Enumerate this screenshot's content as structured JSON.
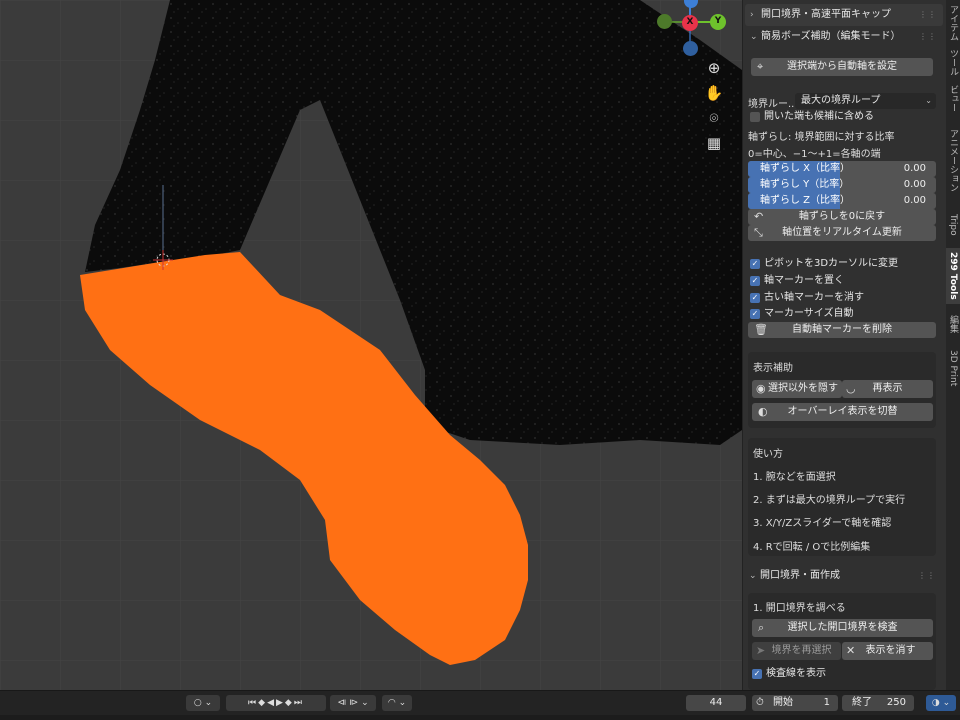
{
  "viewport": {
    "gizmo": {
      "x": "X",
      "y": "Y"
    }
  },
  "panel": {
    "sec1": {
      "title": "開口境界・高速平面キャップ"
    },
    "sec2": {
      "title": "簡易ボーズ補助（編集モード）",
      "auto_axis_btn": "選択端から自動軸を設定",
      "boundary_label": "境界ルー...",
      "boundary_value": "最大の境界ループ",
      "include_open_label": "開いた端も候補に含める",
      "axis_shift_label": "軸ずらし: 境界範囲に対する比率",
      "axis_hint": "0=中心、−1〜+1=各軸の端",
      "sliders": [
        {
          "name": "軸ずらし X（比率）",
          "value": "0.00"
        },
        {
          "name": "軸ずらし Y（比率）",
          "value": "0.00"
        },
        {
          "name": "軸ずらし Z（比率）",
          "value": "0.00"
        }
      ],
      "reset_btn": "軸ずらしを0に戻す",
      "realtime_btn": "軸位置をリアルタイム更新",
      "checks": [
        {
          "label": "ピボットを3Dカーソルに変更",
          "checked": true
        },
        {
          "label": "軸マーカーを置く",
          "checked": true
        },
        {
          "label": "古い軸マーカーを消す",
          "checked": true
        },
        {
          "label": "マーカーサイズ自動",
          "checked": true
        }
      ],
      "delete_marker_btn": "自動軸マーカーを削除",
      "display_title": "表示補助",
      "hide_others_btn": "選択以外を隠す",
      "reveal_btn": "再表示",
      "overlay_btn": "オーバーレイ表示を切替",
      "usage_title": "使い方",
      "usage": [
        "1. 腕などを面選択",
        "2. まずは最大の境界ループで実行",
        "3. X/Y/Zスライダーで軸を確認",
        "4. Rで回転 / Oで比例編集"
      ]
    },
    "sec3": {
      "title": "開口境界・面作成",
      "step1": "1. 開口境界を調べる",
      "inspect_btn": "選択した開口境界を検査",
      "reselect_btn": "境界を再選択",
      "clear_btn": "表示を消す",
      "show_lines": "検査線を表示"
    }
  },
  "tabs": [
    {
      "label": "アイテム",
      "active": false
    },
    {
      "label": "ツール",
      "active": false
    },
    {
      "label": "ビュー",
      "active": false
    },
    {
      "label": "アニメーション",
      "active": false
    },
    {
      "label": "Tripo",
      "active": false
    },
    {
      "label": "299 Tools",
      "active": true
    },
    {
      "label": "編集",
      "active": false
    },
    {
      "label": "3D Print",
      "active": false
    }
  ],
  "timeline": {
    "current_frame": "44",
    "start_label": "開始",
    "start_value": "1",
    "end_label": "終了",
    "end_value": "250"
  },
  "colors": {
    "accent": "#4772b3",
    "mesh_selected": "#ff7014",
    "mesh_unselected": "#0a0a0a",
    "axis_x": "#e8334a",
    "axis_y": "#6ec22c",
    "axis_z": "#3d7fd6"
  }
}
